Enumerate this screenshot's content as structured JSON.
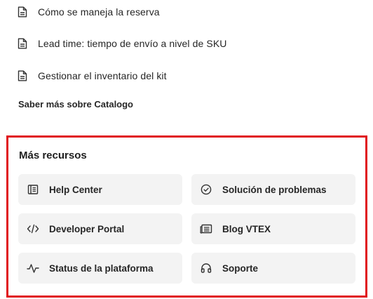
{
  "docs": [
    {
      "label": "Cómo se maneja la reserva",
      "icon": "document-icon"
    },
    {
      "label": "Lead time: tiempo de envío a nivel de SKU",
      "icon": "document-icon"
    },
    {
      "label": "Gestionar el inventario del kit",
      "icon": "document-icon"
    }
  ],
  "learn_more": {
    "label": "Saber más sobre Catalogo"
  },
  "resources": {
    "title": "Más recursos",
    "highlight_color": "#e0141b",
    "cards": [
      {
        "label": "Help Center",
        "icon": "book-icon"
      },
      {
        "label": "Solución de problemas",
        "icon": "check-circle-icon"
      },
      {
        "label": "Developer Portal",
        "icon": "code-icon"
      },
      {
        "label": "Blog VTEX",
        "icon": "newspaper-icon"
      },
      {
        "label": "Status de la plataforma",
        "icon": "activity-icon"
      },
      {
        "label": "Soporte",
        "icon": "headset-icon"
      }
    ]
  }
}
